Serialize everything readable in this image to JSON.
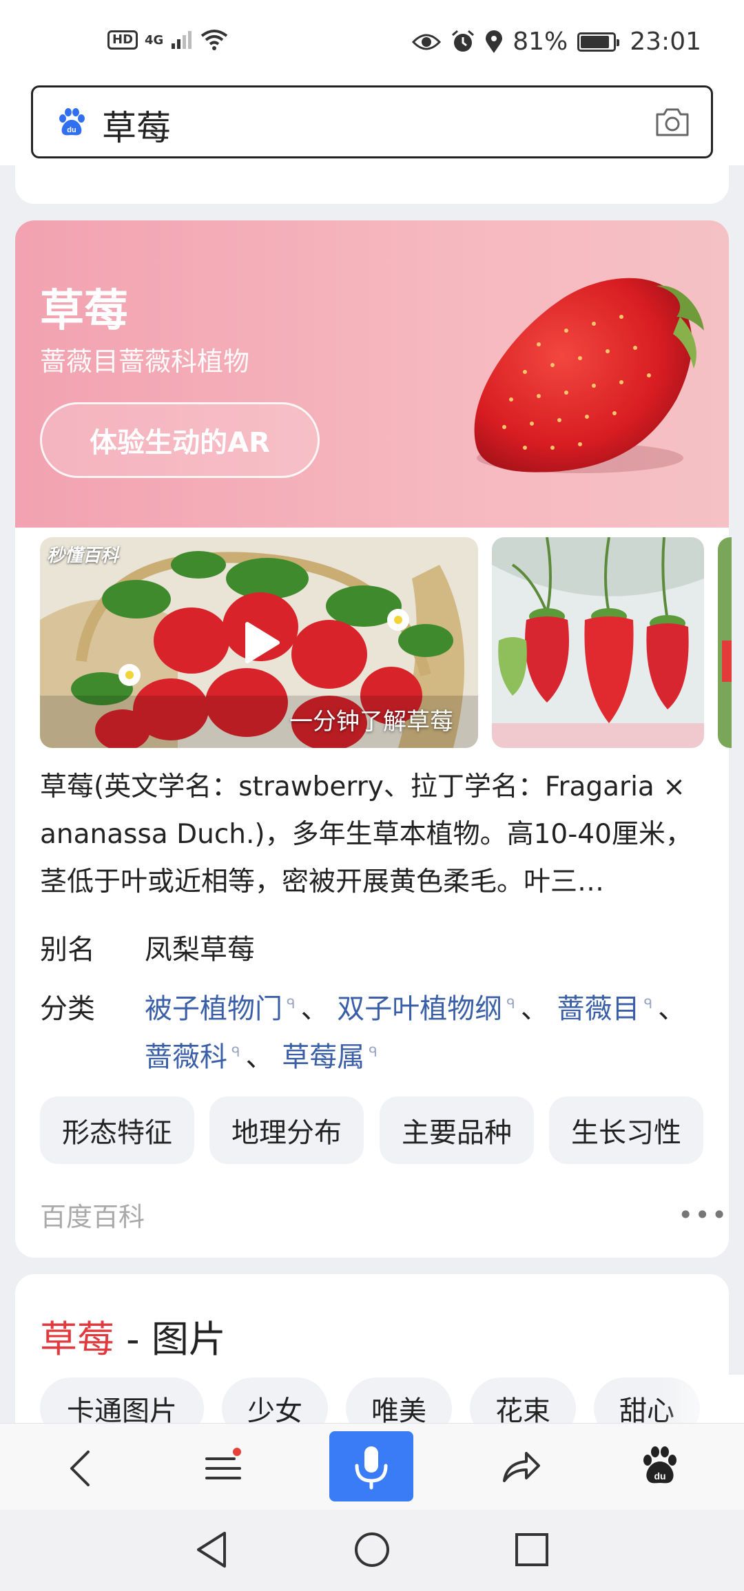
{
  "status_bar": {
    "left_badges": [
      "HD",
      "4G"
    ],
    "battery": "81%",
    "battery_level": 0.81,
    "time": "23:01"
  },
  "search": {
    "query": "草莓"
  },
  "hero": {
    "title": "草莓",
    "subtitle": "蔷薇目蔷薇科植物",
    "ar_button": "体验生动的AR"
  },
  "media": {
    "brand_tag": "秒懂百科",
    "video_caption": "一分钟了解草莓"
  },
  "description": "草莓(英文学名：strawberry、拉丁学名：Fragaria × ananassa Duch.)，多年生草本植物。高10-40厘米，茎低于叶或近相等，密被开展黄色柔毛。叶三…",
  "info": {
    "alias_label": "别名",
    "alias_value": "凤梨草莓",
    "class_label": "分类",
    "class_links": [
      "被子植物门",
      "双子叶植物纲",
      "蔷薇目",
      "蔷薇科",
      "草莓属"
    ],
    "separator": "、"
  },
  "chips": [
    "形态特征",
    "地理分布",
    "主要品种",
    "生长习性"
  ],
  "source": "百度百科",
  "more": "•••",
  "images_section": {
    "keyword": "草莓",
    "suffix": " - 图片",
    "tags": [
      "卡通图片",
      "少女",
      "唯美",
      "花束",
      "甜心"
    ]
  },
  "toolbar": {
    "icons": [
      "back-icon",
      "menu-icon",
      "microphone-icon",
      "share-icon",
      "baidu-paw-icon"
    ],
    "accent_color": "#3a7cf5",
    "notification_dot_color": "#e8413a"
  },
  "colors": {
    "link": "#3a5fa8",
    "keyword_red": "#e1393e",
    "hero_pink": "#f2a2b0"
  }
}
